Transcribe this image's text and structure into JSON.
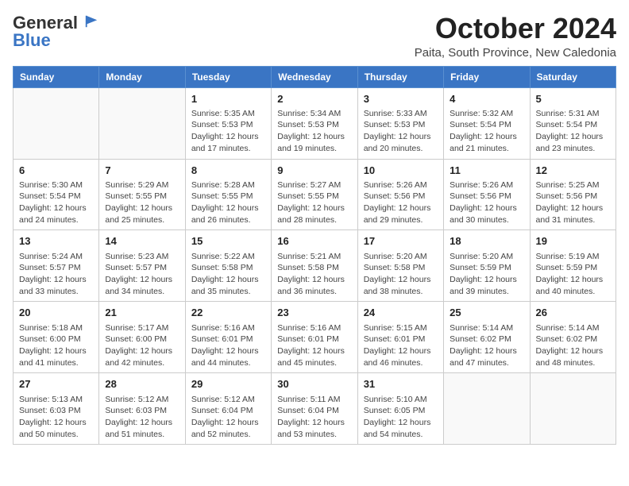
{
  "header": {
    "logo_general": "General",
    "logo_blue": "Blue",
    "month": "October 2024",
    "location": "Paita, South Province, New Caledonia"
  },
  "weekdays": [
    "Sunday",
    "Monday",
    "Tuesday",
    "Wednesday",
    "Thursday",
    "Friday",
    "Saturday"
  ],
  "weeks": [
    [
      {
        "day": "",
        "info": ""
      },
      {
        "day": "",
        "info": ""
      },
      {
        "day": "1",
        "info": "Sunrise: 5:35 AM\nSunset: 5:53 PM\nDaylight: 12 hours\nand 17 minutes."
      },
      {
        "day": "2",
        "info": "Sunrise: 5:34 AM\nSunset: 5:53 PM\nDaylight: 12 hours\nand 19 minutes."
      },
      {
        "day": "3",
        "info": "Sunrise: 5:33 AM\nSunset: 5:53 PM\nDaylight: 12 hours\nand 20 minutes."
      },
      {
        "day": "4",
        "info": "Sunrise: 5:32 AM\nSunset: 5:54 PM\nDaylight: 12 hours\nand 21 minutes."
      },
      {
        "day": "5",
        "info": "Sunrise: 5:31 AM\nSunset: 5:54 PM\nDaylight: 12 hours\nand 23 minutes."
      }
    ],
    [
      {
        "day": "6",
        "info": "Sunrise: 5:30 AM\nSunset: 5:54 PM\nDaylight: 12 hours\nand 24 minutes."
      },
      {
        "day": "7",
        "info": "Sunrise: 5:29 AM\nSunset: 5:55 PM\nDaylight: 12 hours\nand 25 minutes."
      },
      {
        "day": "8",
        "info": "Sunrise: 5:28 AM\nSunset: 5:55 PM\nDaylight: 12 hours\nand 26 minutes."
      },
      {
        "day": "9",
        "info": "Sunrise: 5:27 AM\nSunset: 5:55 PM\nDaylight: 12 hours\nand 28 minutes."
      },
      {
        "day": "10",
        "info": "Sunrise: 5:26 AM\nSunset: 5:56 PM\nDaylight: 12 hours\nand 29 minutes."
      },
      {
        "day": "11",
        "info": "Sunrise: 5:26 AM\nSunset: 5:56 PM\nDaylight: 12 hours\nand 30 minutes."
      },
      {
        "day": "12",
        "info": "Sunrise: 5:25 AM\nSunset: 5:56 PM\nDaylight: 12 hours\nand 31 minutes."
      }
    ],
    [
      {
        "day": "13",
        "info": "Sunrise: 5:24 AM\nSunset: 5:57 PM\nDaylight: 12 hours\nand 33 minutes."
      },
      {
        "day": "14",
        "info": "Sunrise: 5:23 AM\nSunset: 5:57 PM\nDaylight: 12 hours\nand 34 minutes."
      },
      {
        "day": "15",
        "info": "Sunrise: 5:22 AM\nSunset: 5:58 PM\nDaylight: 12 hours\nand 35 minutes."
      },
      {
        "day": "16",
        "info": "Sunrise: 5:21 AM\nSunset: 5:58 PM\nDaylight: 12 hours\nand 36 minutes."
      },
      {
        "day": "17",
        "info": "Sunrise: 5:20 AM\nSunset: 5:58 PM\nDaylight: 12 hours\nand 38 minutes."
      },
      {
        "day": "18",
        "info": "Sunrise: 5:20 AM\nSunset: 5:59 PM\nDaylight: 12 hours\nand 39 minutes."
      },
      {
        "day": "19",
        "info": "Sunrise: 5:19 AM\nSunset: 5:59 PM\nDaylight: 12 hours\nand 40 minutes."
      }
    ],
    [
      {
        "day": "20",
        "info": "Sunrise: 5:18 AM\nSunset: 6:00 PM\nDaylight: 12 hours\nand 41 minutes."
      },
      {
        "day": "21",
        "info": "Sunrise: 5:17 AM\nSunset: 6:00 PM\nDaylight: 12 hours\nand 42 minutes."
      },
      {
        "day": "22",
        "info": "Sunrise: 5:16 AM\nSunset: 6:01 PM\nDaylight: 12 hours\nand 44 minutes."
      },
      {
        "day": "23",
        "info": "Sunrise: 5:16 AM\nSunset: 6:01 PM\nDaylight: 12 hours\nand 45 minutes."
      },
      {
        "day": "24",
        "info": "Sunrise: 5:15 AM\nSunset: 6:01 PM\nDaylight: 12 hours\nand 46 minutes."
      },
      {
        "day": "25",
        "info": "Sunrise: 5:14 AM\nSunset: 6:02 PM\nDaylight: 12 hours\nand 47 minutes."
      },
      {
        "day": "26",
        "info": "Sunrise: 5:14 AM\nSunset: 6:02 PM\nDaylight: 12 hours\nand 48 minutes."
      }
    ],
    [
      {
        "day": "27",
        "info": "Sunrise: 5:13 AM\nSunset: 6:03 PM\nDaylight: 12 hours\nand 50 minutes."
      },
      {
        "day": "28",
        "info": "Sunrise: 5:12 AM\nSunset: 6:03 PM\nDaylight: 12 hours\nand 51 minutes."
      },
      {
        "day": "29",
        "info": "Sunrise: 5:12 AM\nSunset: 6:04 PM\nDaylight: 12 hours\nand 52 minutes."
      },
      {
        "day": "30",
        "info": "Sunrise: 5:11 AM\nSunset: 6:04 PM\nDaylight: 12 hours\nand 53 minutes."
      },
      {
        "day": "31",
        "info": "Sunrise: 5:10 AM\nSunset: 6:05 PM\nDaylight: 12 hours\nand 54 minutes."
      },
      {
        "day": "",
        "info": ""
      },
      {
        "day": "",
        "info": ""
      }
    ]
  ]
}
